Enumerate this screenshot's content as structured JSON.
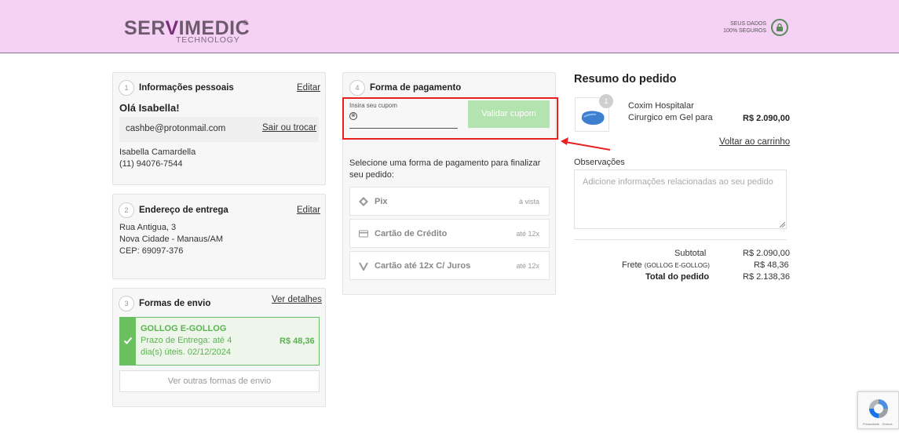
{
  "header": {
    "logo_main_left": "SER",
    "logo_main_v": "V",
    "logo_main_right": "IMEDIC",
    "logo_reg": "®",
    "logo_sub": "TECHNOLOGY",
    "secure_line1": "SEUS DADOS",
    "secure_line2": "100% SEGUROS",
    "secure_icon": "lock-icon"
  },
  "personal": {
    "step": "1",
    "title": "Informações pessoais",
    "edit_label": "Editar",
    "greeting": "Olá Isabella!",
    "email": "cashbe@protonmail.com",
    "logout_label": "Sair ou trocar",
    "name": "Isabella Camardella",
    "phone": "(11) 94076-7544"
  },
  "address": {
    "step": "2",
    "title": "Endereço de entrega",
    "edit_label": "Editar",
    "street": "Rua Antigua, 3",
    "city": "Nova Cidade - Manaus/AM",
    "cep": "CEP: 69097-376"
  },
  "shipping": {
    "step": "3",
    "title": "Formas de envio",
    "details_label": "Ver detalhes",
    "selected_name": "GOLLOG E-GOLLOG",
    "selected_line1": "Prazo de Entrega: até 4",
    "selected_line2": "dia(s) úteis. 02/12/2024",
    "selected_price": "R$ 48,36",
    "other_label": "Ver outras formas de envio"
  },
  "payment": {
    "step": "4",
    "title": "Forma de pagamento",
    "coupon_label": "Insira seu cupom",
    "coupon_value": "",
    "coupon_clear": "⊗",
    "validate_label": "Validar cupom",
    "instruction_line1": "Selecione uma forma de pagamento para finalizar",
    "instruction_line2": "seu pedido:",
    "options": [
      {
        "label": "Pix",
        "tag": "à vista",
        "icon": "pix-icon"
      },
      {
        "label": "Cartão de Crédito",
        "tag": "até 12x",
        "icon": "credit-card-icon"
      },
      {
        "label": "Cartão até 12x C/ Juros",
        "tag": "até 12x",
        "icon": "card-brand-icon"
      }
    ]
  },
  "summary": {
    "title": "Resumo do pedido",
    "product_line1": "Coxim Hospitalar",
    "product_line2": "Cirurgico em Gel para",
    "product_price": "R$ 2.090,00",
    "quantity": "1",
    "back_label": "Voltar ao carrinho",
    "obs_label": "Observações",
    "obs_placeholder": "Adicione informações relacionadas ao seu pedido",
    "subtotal_label": "Subtotal",
    "subtotal_value": "R$ 2.090,00",
    "freight_label": "Frete",
    "freight_sub": "(GOLLOG E-GOLLOG)",
    "freight_value": "R$ 48,36",
    "total_label": "Total do pedido",
    "total_value": "R$ 2.138,36"
  },
  "recaptcha": {
    "footer": "Privacidade - Termos"
  },
  "colors": {
    "header_bg": "#f5d2f5",
    "accent_green": "#6abf5e",
    "highlight_red": "#e82020"
  }
}
